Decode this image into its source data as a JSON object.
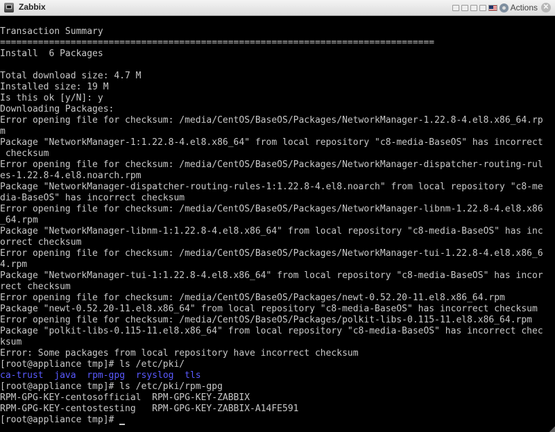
{
  "window": {
    "title": "Zabbix",
    "actions_label": "Actions",
    "close_glyph": "✕"
  },
  "terminal": {
    "lines": [
      "Transaction Summary",
      "================================================================================",
      "Install  6 Packages",
      "",
      "Total download size: 4.7 M",
      "Installed size: 19 M",
      "Is this ok [y/N]: y",
      "Downloading Packages:",
      "Error opening file for checksum: /media/CentOS/BaseOS/Packages/NetworkManager-1.22.8-4.el8.x86_64.rp",
      "m",
      "Package \"NetworkManager-1:1.22.8-4.el8.x86_64\" from local repository \"c8-media-BaseOS\" has incorrect",
      " checksum",
      "Error opening file for checksum: /media/CentOS/BaseOS/Packages/NetworkManager-dispatcher-routing-rul",
      "es-1.22.8-4.el8.noarch.rpm",
      "Package \"NetworkManager-dispatcher-routing-rules-1:1.22.8-4.el8.noarch\" from local repository \"c8-me",
      "dia-BaseOS\" has incorrect checksum",
      "Error opening file for checksum: /media/CentOS/BaseOS/Packages/NetworkManager-libnm-1.22.8-4.el8.x86",
      "_64.rpm",
      "Package \"NetworkManager-libnm-1:1.22.8-4.el8.x86_64\" from local repository \"c8-media-BaseOS\" has inc",
      "orrect checksum",
      "Error opening file for checksum: /media/CentOS/BaseOS/Packages/NetworkManager-tui-1.22.8-4.el8.x86_6",
      "4.rpm",
      "Package \"NetworkManager-tui-1:1.22.8-4.el8.x86_64\" from local repository \"c8-media-BaseOS\" has incor",
      "rect checksum",
      "Error opening file for checksum: /media/CentOS/BaseOS/Packages/newt-0.52.20-11.el8.x86_64.rpm",
      "Package \"newt-0.52.20-11.el8.x86_64\" from local repository \"c8-media-BaseOS\" has incorrect checksum",
      "Error opening file for checksum: /media/CentOS/BaseOS/Packages/polkit-libs-0.115-11.el8.x86_64.rpm",
      "Package \"polkit-libs-0.115-11.el8.x86_64\" from local repository \"c8-media-BaseOS\" has incorrect chec",
      "ksum",
      "Error: Some packages from local repository have incorrect checksum",
      "[root@appliance tmp]# ls /etc/pki/"
    ],
    "dir_listing": [
      "ca-trust",
      "java",
      "rpm-gpg",
      "rsyslog",
      "tls"
    ],
    "lines_after": [
      "[root@appliance tmp]# ls /etc/pki/rpm-gpg",
      "RPM-GPG-KEY-centosofficial  RPM-GPG-KEY-ZABBIX",
      "RPM-GPG-KEY-centostesting   RPM-GPG-KEY-ZABBIX-A14FE591"
    ],
    "prompt": "[root@appliance tmp]# "
  },
  "colors": {
    "background": "#000000",
    "text": "#c8c8c8",
    "directory": "#5a5aff"
  }
}
